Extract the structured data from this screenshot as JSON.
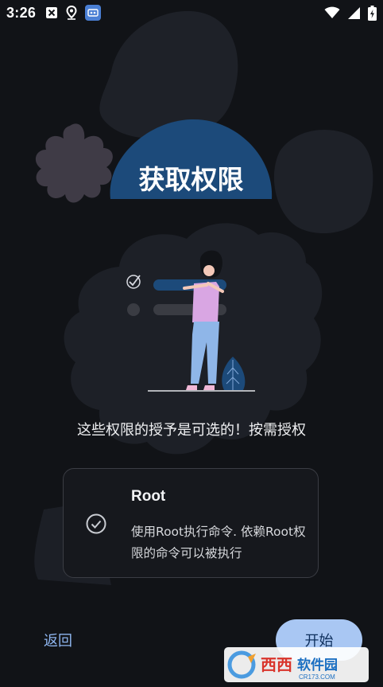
{
  "status_bar": {
    "time": "3:26",
    "left_icons": [
      "close-box-icon",
      "location-pin-icon",
      "app-notification-icon"
    ],
    "right_icons": [
      "wifi-icon",
      "signal-icon",
      "battery-charging-icon"
    ]
  },
  "header": {
    "title": "获取权限"
  },
  "subtitle": "这些权限的授予是可选的！按需授权",
  "permission_card": {
    "title": "Root",
    "description": "使用Root执行命令. 依赖Root权限的命令可以被执行",
    "icon": "check-circle-icon"
  },
  "footer": {
    "back_label": "返回",
    "start_label": "开始"
  },
  "watermark": {
    "brand": "西西软件园",
    "domain": "CR173.COM"
  },
  "colors": {
    "background": "#111317",
    "blob": "#1e2128",
    "title_pill": "#1c4a7a",
    "accent_button": "#a9c7f3",
    "link_text": "#8fb6f0"
  }
}
